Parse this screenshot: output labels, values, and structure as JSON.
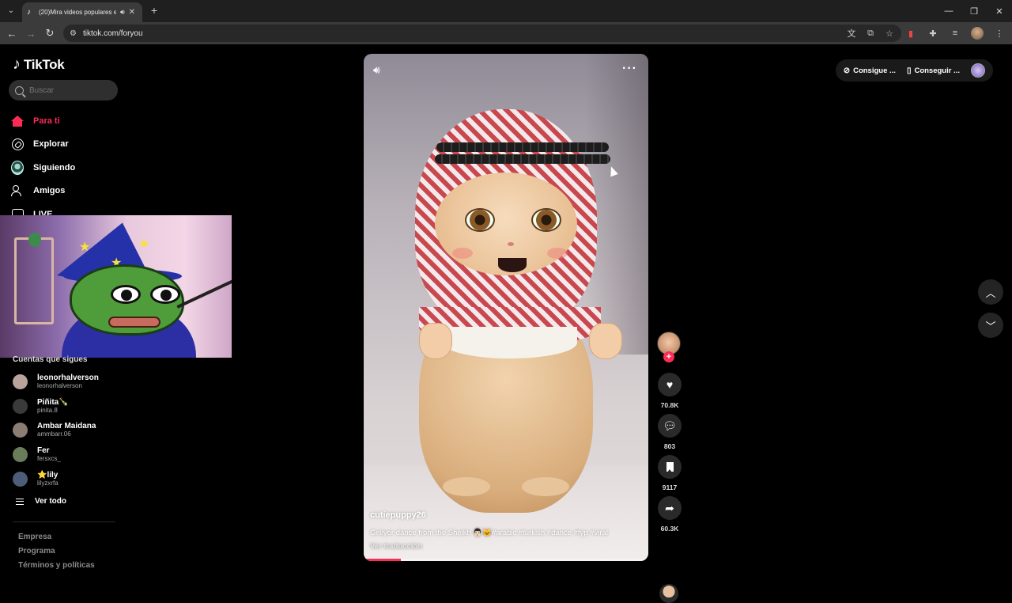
{
  "browser": {
    "tab_title": "(20)Mira videos populares en",
    "tab_icon": "tiktok-icon",
    "url": "tiktok.com/foryou"
  },
  "sidebar": {
    "logo_text": "TikTok",
    "search_placeholder": "Buscar",
    "nav": [
      {
        "label": "Para ti",
        "icon": "home-icon",
        "active": true
      },
      {
        "label": "Explorar",
        "icon": "compass-icon"
      },
      {
        "label": "Siguiendo",
        "icon": "following-icon"
      },
      {
        "label": "Amigos",
        "icon": "friends-icon"
      },
      {
        "label": "LIVE",
        "icon": "live-icon"
      }
    ],
    "following_title": "Cuentas que sigues",
    "accounts": [
      {
        "name": "leonorhalverson",
        "handle": "leonorhalverson",
        "color": "#b9a39a"
      },
      {
        "name": "Piñita🍾",
        "handle": "pinita.8",
        "color": "#3a3a3a"
      },
      {
        "name": "Ambar Maidana",
        "handle": "ammbarr.06",
        "color": "#8b7d72"
      },
      {
        "name": "Fer",
        "handle": "fersxcs_",
        "color": "#6a7d5a"
      },
      {
        "name": "⭐lily",
        "handle": "lilyzxrfa",
        "color": "#4d5d77"
      }
    ],
    "see_all": "Ver todo",
    "footer": [
      "Empresa",
      "Programa",
      "Términos y políticas"
    ]
  },
  "video": {
    "author": "cutiepuppy26",
    "caption": "Geliyor dance from the Sheikh 👨🏻🐱#arabic #turkish #dance #fyp #viral",
    "translate": "Ver traducción",
    "progress_fraction": 0.13
  },
  "actions": {
    "likes": "70.8K",
    "comments": "803",
    "saves": "9117",
    "shares": "60.3K"
  },
  "top_right": {
    "get_app": "Consigue ...",
    "get_desktop": "Conseguir ..."
  },
  "colors": {
    "accent": "#fe2c55"
  }
}
